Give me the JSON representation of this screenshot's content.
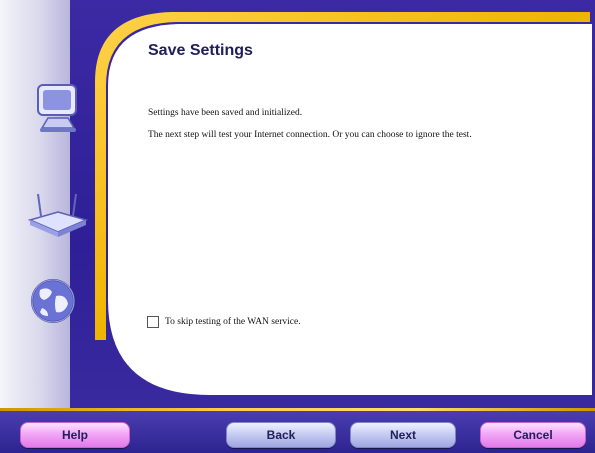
{
  "dialog": {
    "title": "Save Settings",
    "message_line1": "Settings have been saved and initialized.",
    "message_line2": "The next step will test your Internet connection. Or you can choose to ignore the test.",
    "skip_checkbox_label": "To skip testing of the WAN service.",
    "skip_checkbox_checked": false
  },
  "buttons": {
    "help": "Help",
    "back": "Back",
    "next": "Next",
    "cancel": "Cancel"
  },
  "sidebar_icons": [
    "computer-icon",
    "router-icon",
    "globe-icon"
  ],
  "colors": {
    "background_purple": "#2f1f97",
    "accent_gold": "#ffd24a",
    "panel_white": "#ffffff",
    "help_cancel_pink": "#f2a7f7",
    "back_next_blue": "#c8cdf3"
  }
}
